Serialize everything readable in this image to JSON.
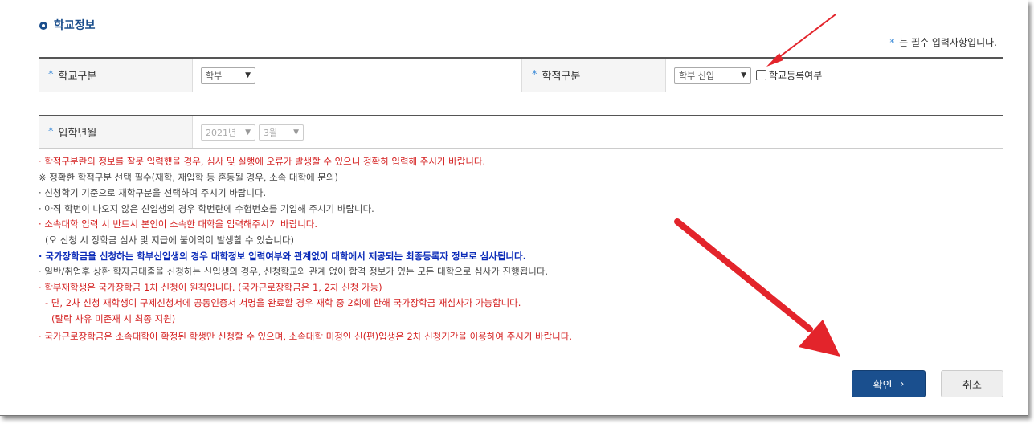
{
  "section": {
    "title": "학교정보"
  },
  "required_note": {
    "star": "*",
    "text": "는 필수 입력사항입니다."
  },
  "fields": {
    "school_type": {
      "label": "학교구분",
      "value": "학부"
    },
    "academic_status": {
      "label": "학적구분",
      "value": "학부 신입",
      "checkbox_label": "학교등록여부"
    },
    "admission": {
      "label": "입학년월",
      "year": "2021년",
      "month": "3월"
    }
  },
  "notes": [
    {
      "text": "학적구분란의 정보를 잘못 입력했을 경우, 심사 및 실행에 오류가 발생할 수 있으니 정확히 입력해 주시기 바랍니다.",
      "style": "red",
      "bullet": "·"
    },
    {
      "text": "※ 정확한 학적구분 선택 필수(재학, 재입학 등 혼동될 경우, 소속 대학에 문의)",
      "style": "gray",
      "bullet": ""
    },
    {
      "text": "신청학기 기준으로 재학구분을 선택하여 주시기 바랍니다.",
      "style": "gray",
      "bullet": "·"
    },
    {
      "text": "아직 학번이 나오지 않은 신입생의 경우 학번란에 수험번호를 기입해 주시기 바랍니다.",
      "style": "gray",
      "bullet": "·"
    },
    {
      "text": "소속대학 입력 시 반드시 본인이 소속한 대학을 입력해주시기 바랍니다.",
      "style": "red",
      "bullet": "·"
    },
    {
      "text": "(오 신청 시 장학금 심사 및 지급에 불이익이 발생할 수 있습니다)",
      "style": "gray indent",
      "bullet": ""
    },
    {
      "text": "국가장학금을 신청하는 학부신입생의 경우 대학정보 입력여부와 관계없이 대학에서 제공되는 최종등록자 정보로 심사됩니다.",
      "style": "blue",
      "bullet": "·"
    },
    {
      "text": "일반/취업후 상환 학자금대출을 신청하는 신입생의 경우, 신청학교와 관계 없이 합격 정보가 있는 모든 대학으로 심사가 진행됩니다.",
      "style": "gray",
      "bullet": "·"
    },
    {
      "text": "학부재학생은 국가장학금 1차 신청이 원칙입니다. (국가근로장학금은 1, 2차 신청 가능)",
      "style": "red",
      "bullet": "·"
    },
    {
      "text": "- 단, 2차 신청 재학생이 구제신청서에 공동인증서 서명을 완료할 경우 재학 중 2회에 한해 국가장학금 재심사가 가능합니다.",
      "style": "red indent",
      "bullet": ""
    },
    {
      "text": "(탈락 사유 미존재 시 최종 지원)",
      "style": "red indent",
      "bullet": ""
    },
    {
      "text": "국가근로장학금은 소속대학이 확정된 학생만 신청할 수 있으며, 소속대학 미정인 신(편)입생은 2차 신청기간을 이용하여 주시기 바랍니다.",
      "style": "red",
      "bullet": "·"
    }
  ],
  "buttons": {
    "confirm": "확인",
    "confirm_arrow": "›",
    "cancel": "취소"
  },
  "colors": {
    "primary": "#1a4f8e",
    "annotation_arrow": "#e3242b",
    "warning": "#d42020",
    "emphasis": "#0b2bb8"
  }
}
